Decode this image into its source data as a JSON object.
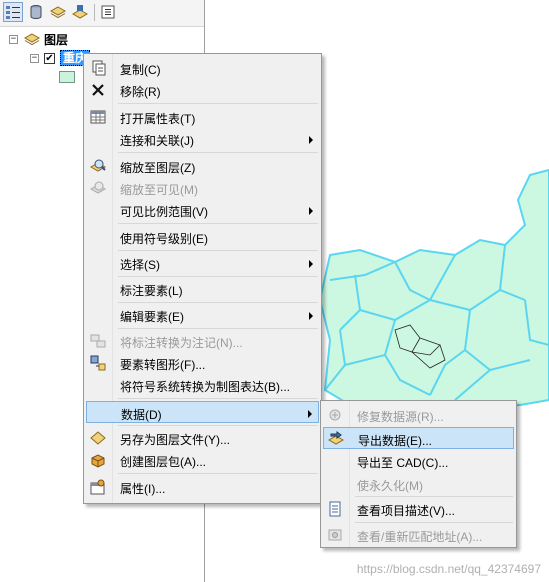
{
  "toc": {
    "root_layer": "图层",
    "layer_name": "重庆",
    "layer_checked": "✔",
    "expander_root": "−",
    "expander_layer": "−"
  },
  "context_menu": {
    "items": [
      {
        "label": "复制(C)",
        "icon": "copy-icon",
        "enabled": true
      },
      {
        "label": "移除(R)",
        "icon": "remove-x-icon",
        "enabled": true
      },
      {
        "label": "打开属性表(T)",
        "icon": "table-icon",
        "enabled": true
      },
      {
        "label": "连接和关联(J)",
        "enabled": true,
        "submenu": true
      },
      {
        "label": "缩放至图层(Z)",
        "icon": "zoom-to-layer-icon",
        "enabled": true
      },
      {
        "label": "缩放至可见(M)",
        "icon": "zoom-to-visible-icon",
        "enabled": false
      },
      {
        "label": "可见比例范围(V)",
        "enabled": true,
        "submenu": true
      },
      {
        "label": "使用符号级别(E)",
        "enabled": true
      },
      {
        "label": "选择(S)",
        "enabled": true,
        "submenu": true
      },
      {
        "label": "标注要素(L)",
        "enabled": true
      },
      {
        "label": "编辑要素(E)",
        "enabled": true,
        "submenu": true
      },
      {
        "label": "将标注转换为注记(N)...",
        "icon": "convert-labels-icon",
        "enabled": false
      },
      {
        "label": "要素转图形(F)...",
        "icon": "features-to-graphics-icon",
        "enabled": true
      },
      {
        "label": "将符号系统转换为制图表达(B)...",
        "enabled": true
      },
      {
        "label": "数据(D)",
        "enabled": true,
        "submenu": true,
        "highlighted": true
      },
      {
        "label": "另存为图层文件(Y)...",
        "icon": "layer-file-icon",
        "enabled": true
      },
      {
        "label": "创建图层包(A)...",
        "icon": "layer-package-icon",
        "enabled": true
      },
      {
        "label": "属性(I)...",
        "icon": "properties-icon",
        "enabled": true
      }
    ]
  },
  "data_submenu": {
    "items": [
      {
        "label": "修复数据源(R)...",
        "icon": "repair-source-icon",
        "enabled": false
      },
      {
        "label": "导出数据(E)...",
        "icon": "export-data-icon",
        "enabled": true,
        "highlighted": true
      },
      {
        "label": "导出至 CAD(C)...",
        "enabled": true
      },
      {
        "label": "使永久化(M)",
        "enabled": false
      },
      {
        "label": "查看项目描述(V)...",
        "icon": "item-description-icon",
        "enabled": true
      },
      {
        "label": "查看/重新匹配地址(A)...",
        "icon": "geocode-icon",
        "enabled": false
      }
    ]
  },
  "watermark": "https://blog.csdn.net/qq_42374697",
  "colors": {
    "map_fill": "#ccf7e0",
    "map_boundary": "#5ad6f0",
    "highlight": "#cce4f7",
    "selection_blue": "#3399ff"
  }
}
